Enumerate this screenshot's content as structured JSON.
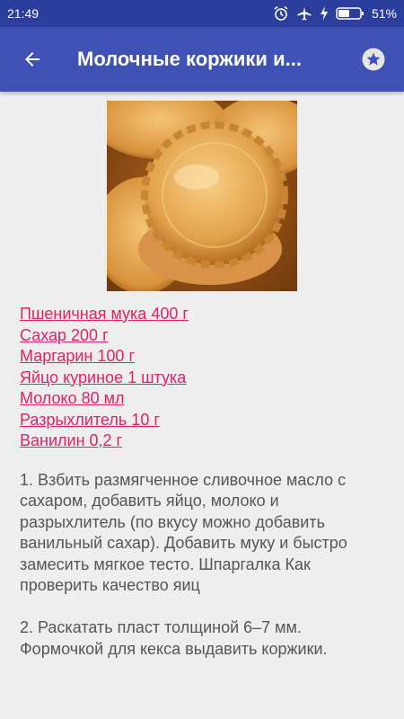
{
  "status_bar": {
    "time": "21:49",
    "battery": "51%",
    "icons": [
      "alarm-icon",
      "airplane-icon",
      "charging-icon",
      "battery-icon"
    ]
  },
  "app_bar": {
    "title": "Молочные коржики и...",
    "back_icon": "arrow-back-icon",
    "favorite_icon": "star-icon"
  },
  "recipe": {
    "image": "baked-cookies-photo",
    "ingredients": [
      "Пшеничная мука 400 г",
      "Сахар 200 г",
      "Маргарин 100 г",
      "Яйцо куриное 1 штука",
      "Молоко 80 мл",
      "Разрыхлитель 10 г",
      "Ванилин 0,2 г"
    ],
    "steps": [
      "1. Взбить размягченное сливочное масло с сахаром, добавить яйцо, молоко и разрыхлитель (по вкусу можно добавить ванильный сахар). Добавить муку и быстро замесить мягкое тесто. Шпаргалка Как проверить качество яиц",
      "2. Раскатать пласт толщиной 6–7 мм. Формочкой для кекса выдавить коржики."
    ]
  },
  "colors": {
    "status_bar": "#2c3e9b",
    "app_bar": "#3f51b5",
    "link": "#e91e63",
    "body_text": "#555555",
    "background": "#eeeeee"
  }
}
